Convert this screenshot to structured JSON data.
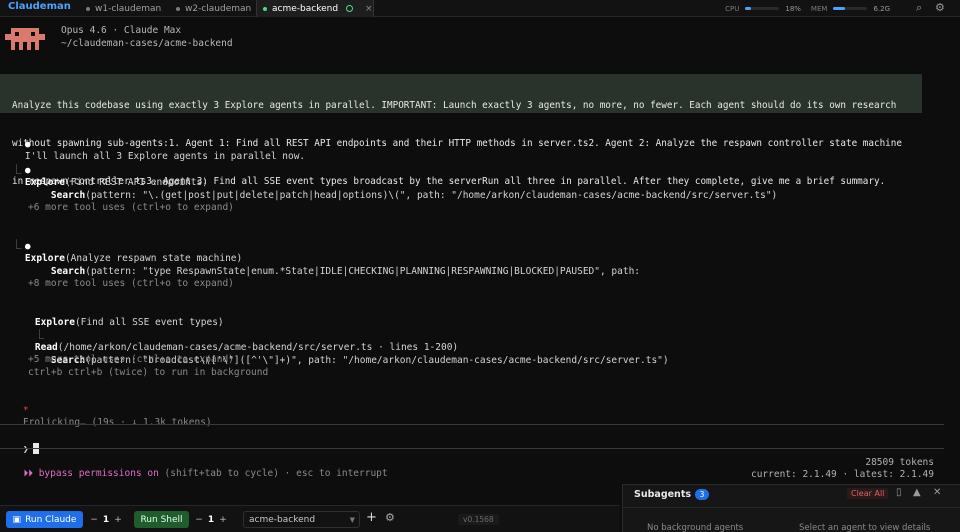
{
  "topbar": {
    "brand": "Claudeman",
    "tabs": [
      {
        "label": "w1-claudeman"
      },
      {
        "label": "w2-claudeman"
      },
      {
        "label": "acme-backend",
        "close": "×"
      }
    ],
    "cpu_label": "CPU",
    "cpu_value": "18%",
    "cpu_fraction": 0.18,
    "mem_label": "MEM",
    "mem_value": "6.2G",
    "mem_fraction": 0.35
  },
  "header": {
    "model": "Opus 4.6 · Claude Max",
    "path": "~/claudeman-cases/acme-backend"
  },
  "prompt_lines": [
    "Analyze this codebase using exactly 3 Explore agents in parallel. IMPORTANT: Launch exactly 3 agents, no more, no fewer. Each agent should do its own research",
    "without spawning sub-agents:1. Agent 1: Find all REST API endpoints and their HTTP methods in server.ts2. Agent 2: Analyze the respawn controller state machine",
    "in respawn-controller.ts3. Agent 3: Find all SSE event types broadcast by the serverRun all three in parallel. After they complete, give me a brief summary."
  ],
  "transcript": {
    "intro": "I'll launch all 3 Explore agents in parallel now.",
    "agent1_title": "Explore",
    "agent1_desc": "(Find REST API endpoints)",
    "agent1_tool": "Search",
    "agent1_args": "(pattern: \"\\.(get|post|put|delete|patch|head|options)\\(\", path: \"/home/arkon/claudeman-cases/acme-backend/src/server.ts\")",
    "agent1_more": "+6 more tool uses (ctrl+o to expand)",
    "agent2_title": "Explore",
    "agent2_desc": "(Analyze respawn state machine)",
    "agent2_tool": "Search",
    "agent2_args": "(pattern: \"type RespawnState|enum.*State|IDLE|CHECKING|PLANNING|RESPAWNING|BLOCKED|PAUSED\", path:",
    "agent2_more": "+8 more tool uses (ctrl+o to expand)",
    "agent3_title": "Explore",
    "agent3_desc": "(Find all SSE event types)",
    "agent3_read_tool": "Read",
    "agent3_read_args": "(/home/arkon/claudeman-cases/acme-backend/src/server.ts · lines 1-200)",
    "agent3_tool": "Search",
    "agent3_args": "(pattern: \"broadcast\\(['\\\"]([^'\\\"]+)\", path: \"/home/arkon/claudeman-cases/acme-backend/src/server.ts\")",
    "agent3_more": "+5 more tool uses (ctrl+o to expand)",
    "agent3_hint": "ctrl+b ctrl+b (twice) to run in background",
    "spinner": "Frolicking… (19s · ↓ 1.3k tokens)",
    "input_prompt": "❯"
  },
  "status": {
    "mode": "bypass permissions on",
    "hint": "(shift+tab to cycle) · esc to interrupt",
    "tokens": "28509 tokens",
    "versions": "current: 2.1.49 · latest: 2.1.49"
  },
  "toolbar": {
    "run_claude": "Run Claude",
    "claude_count": "1",
    "run_shell": "Run Shell",
    "shell_count": "1",
    "minus": "−",
    "plus": "+",
    "session_select": "acme-backend",
    "version": "v0.1568"
  },
  "subagents": {
    "title": "Subagents",
    "count": "3",
    "clear_label": "Clear All",
    "empty_text": "No background agents",
    "hint_text": "Select an agent to view details"
  },
  "colors": {
    "accent": "#1f6feb",
    "brand": "#4aa3ff",
    "prompt_bg": "#2a322c",
    "bypass": "#e06cc8"
  }
}
